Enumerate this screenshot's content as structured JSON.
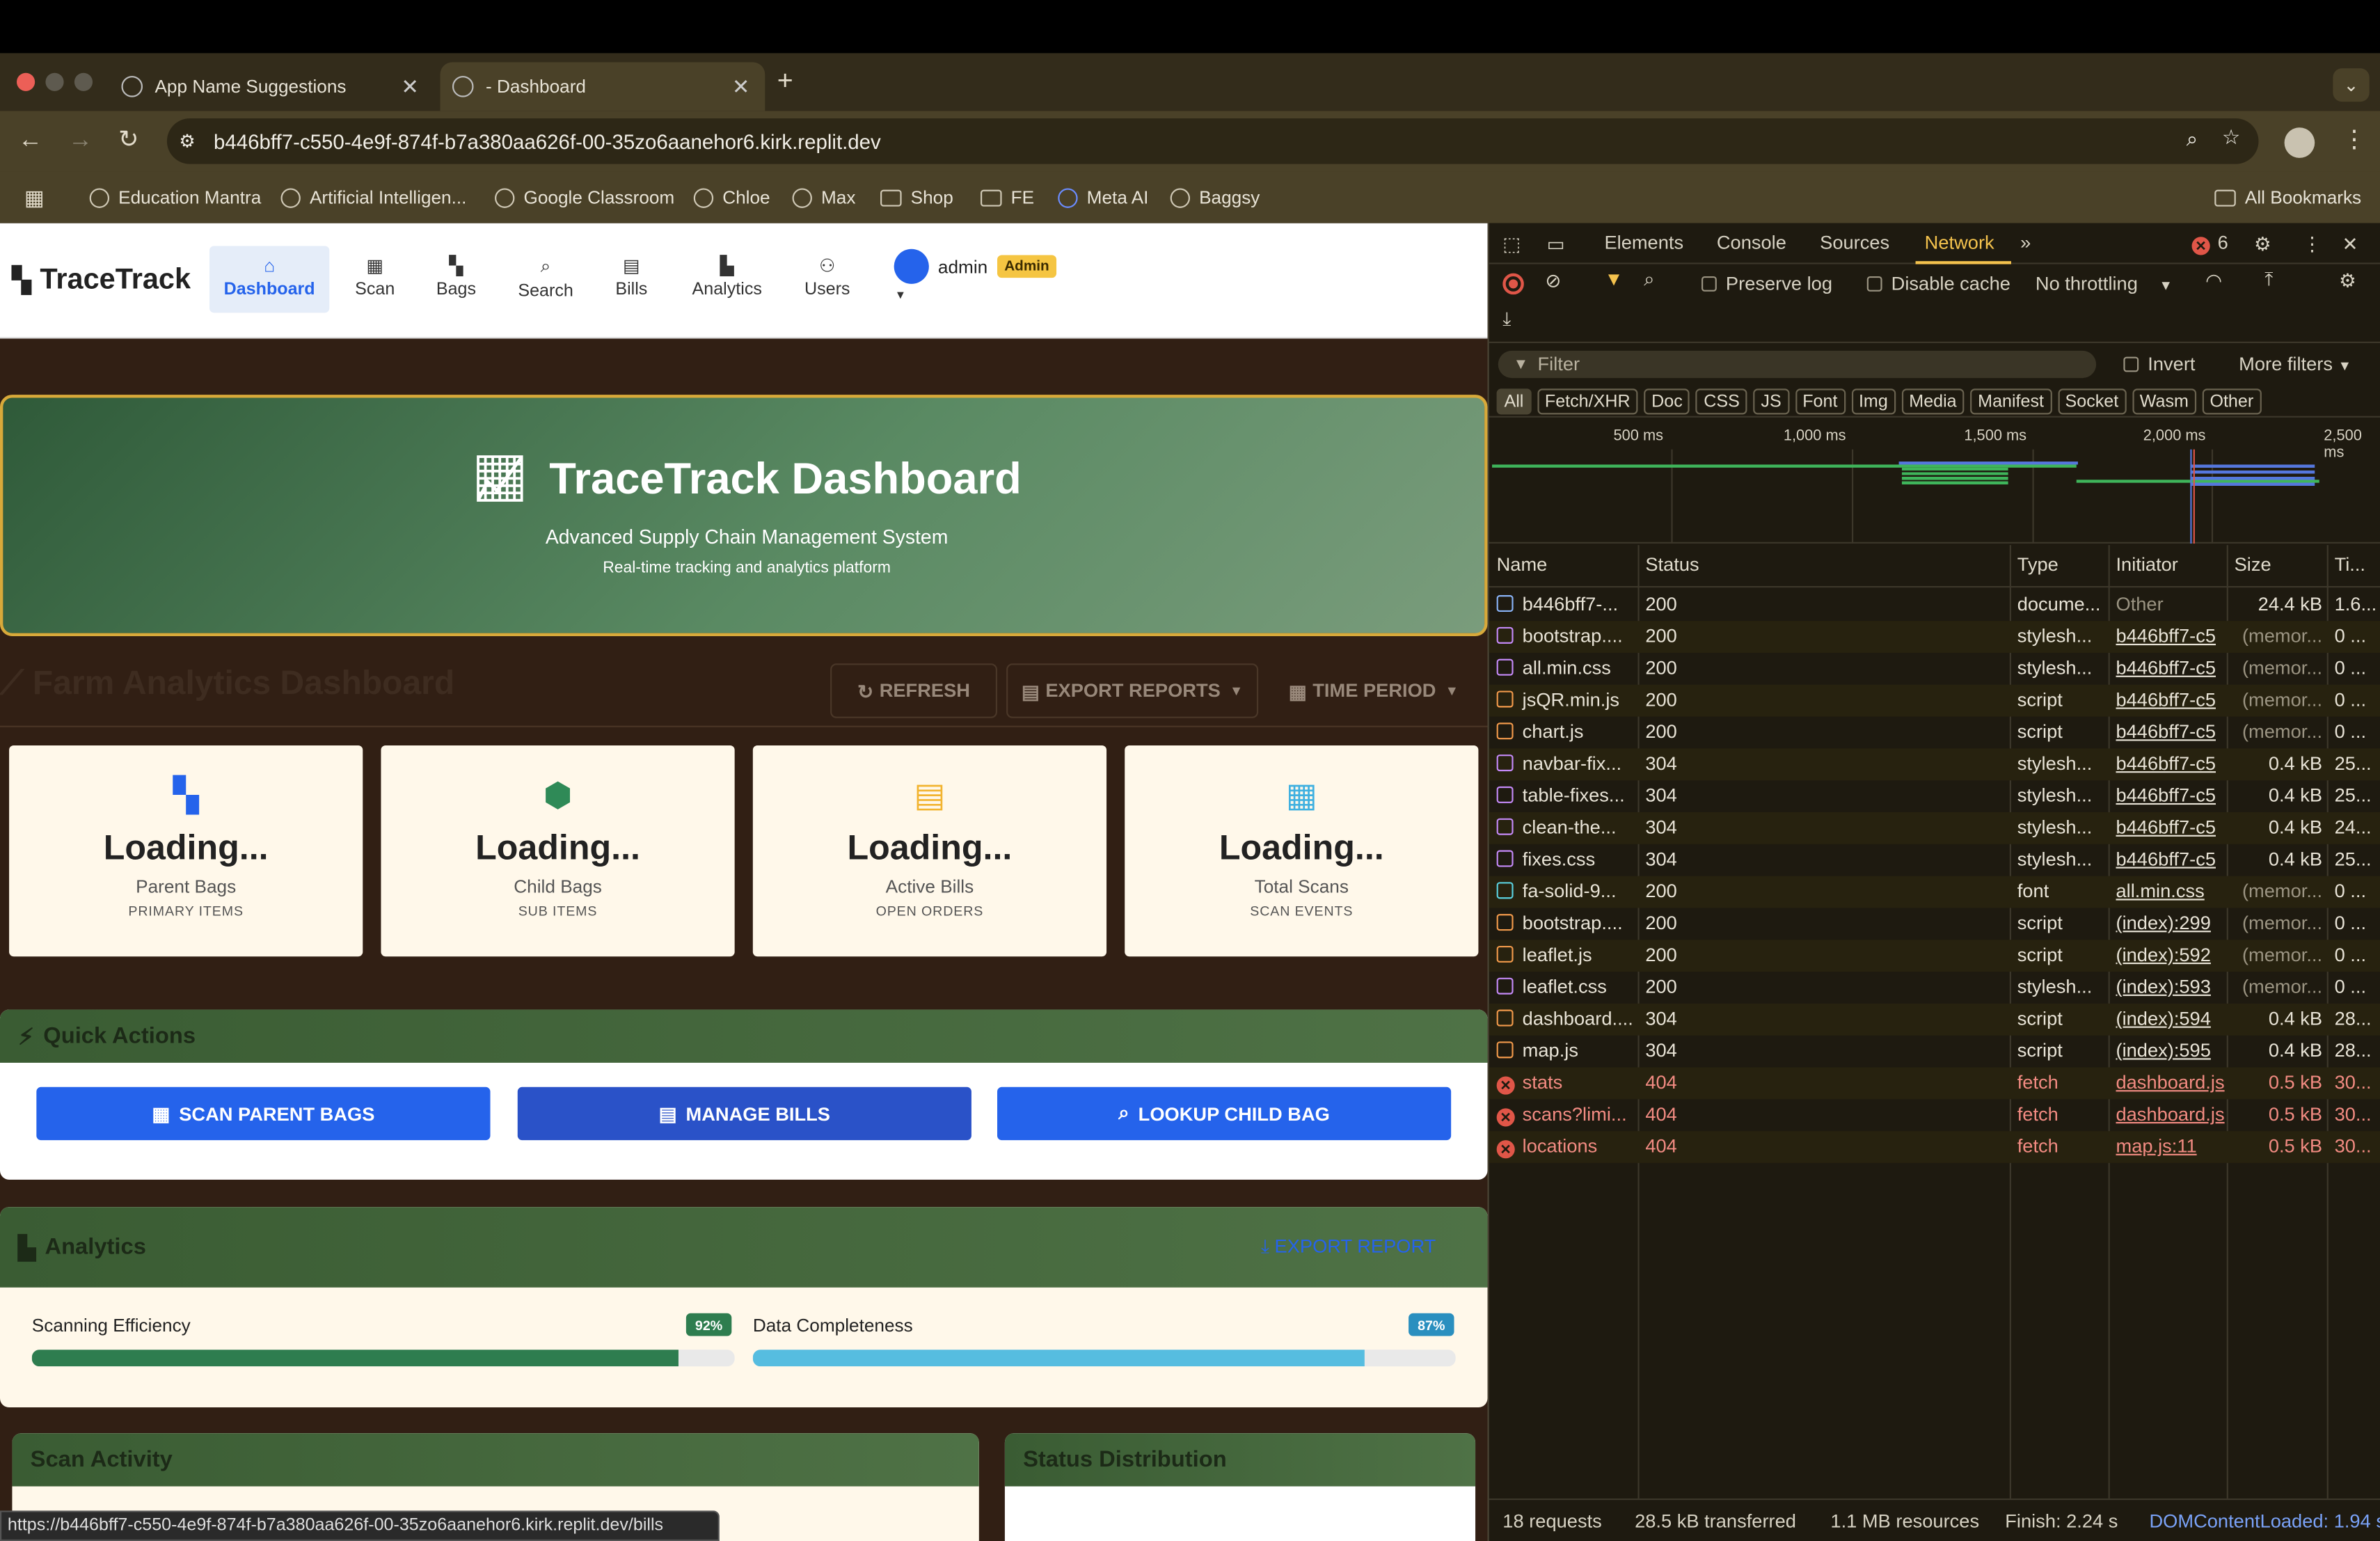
{
  "browser": {
    "tabs": [
      {
        "title": "App Name Suggestions"
      },
      {
        "title": "- Dashboard"
      }
    ],
    "url": "b446bff7-c550-4e9f-874f-b7a380aa626f-00-35zo6aanehor6.kirk.replit.dev",
    "bookmarks": [
      "Education Mantra",
      "Artificial Intelligen...",
      "Google Classroom",
      "Chloe",
      "Max",
      "Shop",
      "FE",
      "Meta AI",
      "Baggsy"
    ],
    "all_bookmarks": "All Bookmarks",
    "status_url": "https://b446bff7-c550-4e9f-874f-b7a380aa626f-00-35zo6aanehor6.kirk.replit.dev/bills"
  },
  "app": {
    "brand": "TraceTrack",
    "nav": [
      {
        "label": "Dashboard",
        "icon": "home-icon"
      },
      {
        "label": "Scan",
        "icon": "qr-icon"
      },
      {
        "label": "Bags",
        "icon": "boxes-icon"
      },
      {
        "label": "Search",
        "icon": "search-icon"
      },
      {
        "label": "Bills",
        "icon": "file-icon"
      },
      {
        "label": "Analytics",
        "icon": "chart-icon"
      },
      {
        "label": "Users",
        "icon": "users-icon"
      }
    ],
    "user": "admin",
    "role_badge": "Admin",
    "hero": {
      "title": "TraceTrack Dashboard",
      "subtitle": "Advanced Supply Chain Management System",
      "tagline": "Real-time tracking and analytics platform"
    },
    "section_title": "Farm Analytics Dashboard",
    "buttons": {
      "refresh": "REFRESH",
      "export": "EXPORT REPORTS",
      "period": "TIME PERIOD"
    },
    "stats": [
      {
        "value": "Loading...",
        "label": "Parent Bags",
        "sub": "PRIMARY ITEMS",
        "icon": "boxes-icon",
        "color": "#2563eb"
      },
      {
        "value": "Loading...",
        "label": "Child Bags",
        "sub": "SUB ITEMS",
        "icon": "box-icon",
        "color": "#2f8a57"
      },
      {
        "value": "Loading...",
        "label": "Active Bills",
        "sub": "OPEN ORDERS",
        "icon": "file-icon",
        "color": "#f2b430"
      },
      {
        "value": "Loading...",
        "label": "Total Scans",
        "sub": "SCAN EVENTS",
        "icon": "qr-icon",
        "color": "#3fb0e0"
      }
    ],
    "quick_actions": {
      "title": "Quick Actions",
      "buttons": [
        "SCAN PARENT BAGS",
        "MANAGE BILLS",
        "LOOKUP CHILD BAG"
      ]
    },
    "analytics": {
      "title": "Analytics",
      "export": "EXPORT REPORT",
      "metrics": [
        {
          "label": "Scanning Efficiency",
          "value": 92,
          "badge": "92%",
          "color": "#2e7d4f"
        },
        {
          "label": "Data Completeness",
          "value": 87,
          "badge": "87%",
          "color": "#56bde0"
        }
      ]
    },
    "scan_activity": "Scan Activity",
    "status_distribution": "Status Distribution"
  },
  "devtools": {
    "tabs": [
      "Elements",
      "Console",
      "Sources",
      "Network"
    ],
    "error_count": "6",
    "preserve_log": "Preserve log",
    "disable_cache": "Disable cache",
    "throttling": "No throttling",
    "filter_placeholder": "Filter",
    "invert": "Invert",
    "more_filters": "More filters",
    "type_filters": [
      "All",
      "Fetch/XHR",
      "Doc",
      "CSS",
      "JS",
      "Font",
      "Img",
      "Media",
      "Manifest",
      "Socket",
      "Wasm",
      "Other"
    ],
    "timeline_labels": [
      "500 ms",
      "1,000 ms",
      "1,500 ms",
      "2,000 ms",
      "2,500 ms"
    ],
    "columns": [
      "Name",
      "Status",
      "Type",
      "Initiator",
      "Size",
      "Ti..."
    ],
    "rows": [
      {
        "name": "b446bff7-...",
        "status": "200",
        "type": "docume...",
        "initiator": "Other",
        "size": "24.4 kB",
        "time": "1.6...",
        "kind": "doc"
      },
      {
        "name": "bootstrap....",
        "status": "200",
        "type": "stylesh...",
        "initiator": "b446bff7-c5",
        "size": "(memor...",
        "time": "0 ...",
        "kind": "css"
      },
      {
        "name": "all.min.css",
        "status": "200",
        "type": "stylesh...",
        "initiator": "b446bff7-c5",
        "size": "(memor...",
        "time": "0 ...",
        "kind": "css"
      },
      {
        "name": "jsQR.min.js",
        "status": "200",
        "type": "script",
        "initiator": "b446bff7-c5",
        "size": "(memor...",
        "time": "0 ...",
        "kind": "js"
      },
      {
        "name": "chart.js",
        "status": "200",
        "type": "script",
        "initiator": "b446bff7-c5",
        "size": "(memor...",
        "time": "0 ...",
        "kind": "js"
      },
      {
        "name": "navbar-fix...",
        "status": "304",
        "type": "stylesh...",
        "initiator": "b446bff7-c5",
        "size": "0.4 kB",
        "time": "25...",
        "kind": "css"
      },
      {
        "name": "table-fixes...",
        "status": "304",
        "type": "stylesh...",
        "initiator": "b446bff7-c5",
        "size": "0.4 kB",
        "time": "25...",
        "kind": "css"
      },
      {
        "name": "clean-the...",
        "status": "304",
        "type": "stylesh...",
        "initiator": "b446bff7-c5",
        "size": "0.4 kB",
        "time": "24...",
        "kind": "css"
      },
      {
        "name": "fixes.css",
        "status": "304",
        "type": "stylesh...",
        "initiator": "b446bff7-c5",
        "size": "0.4 kB",
        "time": "25...",
        "kind": "css"
      },
      {
        "name": "fa-solid-9...",
        "status": "200",
        "type": "font",
        "initiator": "all.min.css",
        "size": "(memor...",
        "time": "0 ...",
        "kind": "font"
      },
      {
        "name": "bootstrap....",
        "status": "200",
        "type": "script",
        "initiator": "(index):299",
        "size": "(memor...",
        "time": "0 ...",
        "kind": "js"
      },
      {
        "name": "leaflet.js",
        "status": "200",
        "type": "script",
        "initiator": "(index):592",
        "size": "(memor...",
        "time": "0 ...",
        "kind": "js"
      },
      {
        "name": "leaflet.css",
        "status": "200",
        "type": "stylesh...",
        "initiator": "(index):593",
        "size": "(memor...",
        "time": "0 ...",
        "kind": "css"
      },
      {
        "name": "dashboard....",
        "status": "304",
        "type": "script",
        "initiator": "(index):594",
        "size": "0.4 kB",
        "time": "28...",
        "kind": "js"
      },
      {
        "name": "map.js",
        "status": "304",
        "type": "script",
        "initiator": "(index):595",
        "size": "0.4 kB",
        "time": "28...",
        "kind": "js"
      },
      {
        "name": "stats",
        "status": "404",
        "type": "fetch",
        "initiator": "dashboard.js",
        "size": "0.5 kB",
        "time": "30...",
        "kind": "err"
      },
      {
        "name": "scans?limi...",
        "status": "404",
        "type": "fetch",
        "initiator": "dashboard.js",
        "size": "0.5 kB",
        "time": "30...",
        "kind": "err"
      },
      {
        "name": "locations",
        "status": "404",
        "type": "fetch",
        "initiator": "map.js:11",
        "size": "0.5 kB",
        "time": "30...",
        "kind": "err"
      }
    ],
    "status_bar": {
      "requests": "18 requests",
      "transferred": "28.5 kB transferred",
      "resources": "1.1 MB resources",
      "finish": "Finish: 2.24 s",
      "dcl": "DOMContentLoaded: 1.94 s"
    }
  }
}
